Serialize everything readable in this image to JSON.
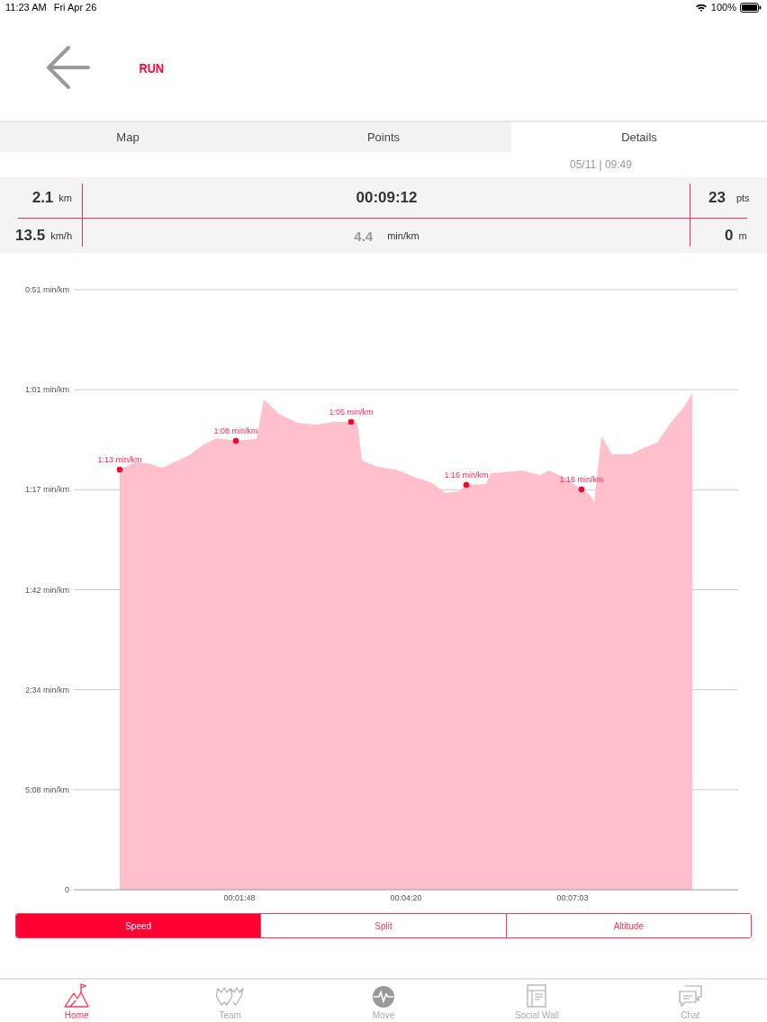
{
  "status_bar": {
    "time": "11:23 AM",
    "date": "Fri Apr 26",
    "battery": "100%"
  },
  "header": {
    "title": "RUN"
  },
  "tabs": [
    {
      "label": "Map",
      "selected": false
    },
    {
      "label": "Points",
      "selected": false
    },
    {
      "label": "Details",
      "selected": true
    }
  ],
  "timestamp": "05/11 | 09:49",
  "stats": {
    "distance": {
      "value": "2.1",
      "unit": "km"
    },
    "duration": {
      "value": "00:09:12"
    },
    "points": {
      "value": "23",
      "unit": "pts"
    },
    "speed": {
      "value": "13.5",
      "unit": "km/h"
    },
    "pace": {
      "value": "4.4",
      "unit": "min/km"
    },
    "elevation": {
      "value": "0",
      "unit": "m"
    }
  },
  "chart": {
    "y_labels": [
      "0:51 min/km",
      "1:01 min/km",
      "1:17 min/km",
      "1:42 min/km",
      "2:34 min/km",
      "5:08 min/km",
      "0"
    ],
    "x_labels": [
      "00:01:48",
      "00:04:20",
      "00:07:03"
    ],
    "point_labels": [
      "1:13 min/km",
      "1:08 min/km",
      "1:05 min/km",
      "1:16 min/km",
      "1:16 min/km"
    ]
  },
  "chart_modes": [
    {
      "label": "Speed",
      "selected": true
    },
    {
      "label": "Split",
      "selected": false
    },
    {
      "label": "Altitude",
      "selected": false
    }
  ],
  "tab_bar": [
    {
      "kind": "home",
      "label": "Home",
      "selected": true
    },
    {
      "kind": "team",
      "label": "Team",
      "selected": false
    },
    {
      "kind": "move",
      "label": "Move",
      "selected": false
    },
    {
      "kind": "wall",
      "label": "Social Wall",
      "selected": false
    },
    {
      "kind": "chat",
      "label": "Chat",
      "selected": false
    }
  ]
}
